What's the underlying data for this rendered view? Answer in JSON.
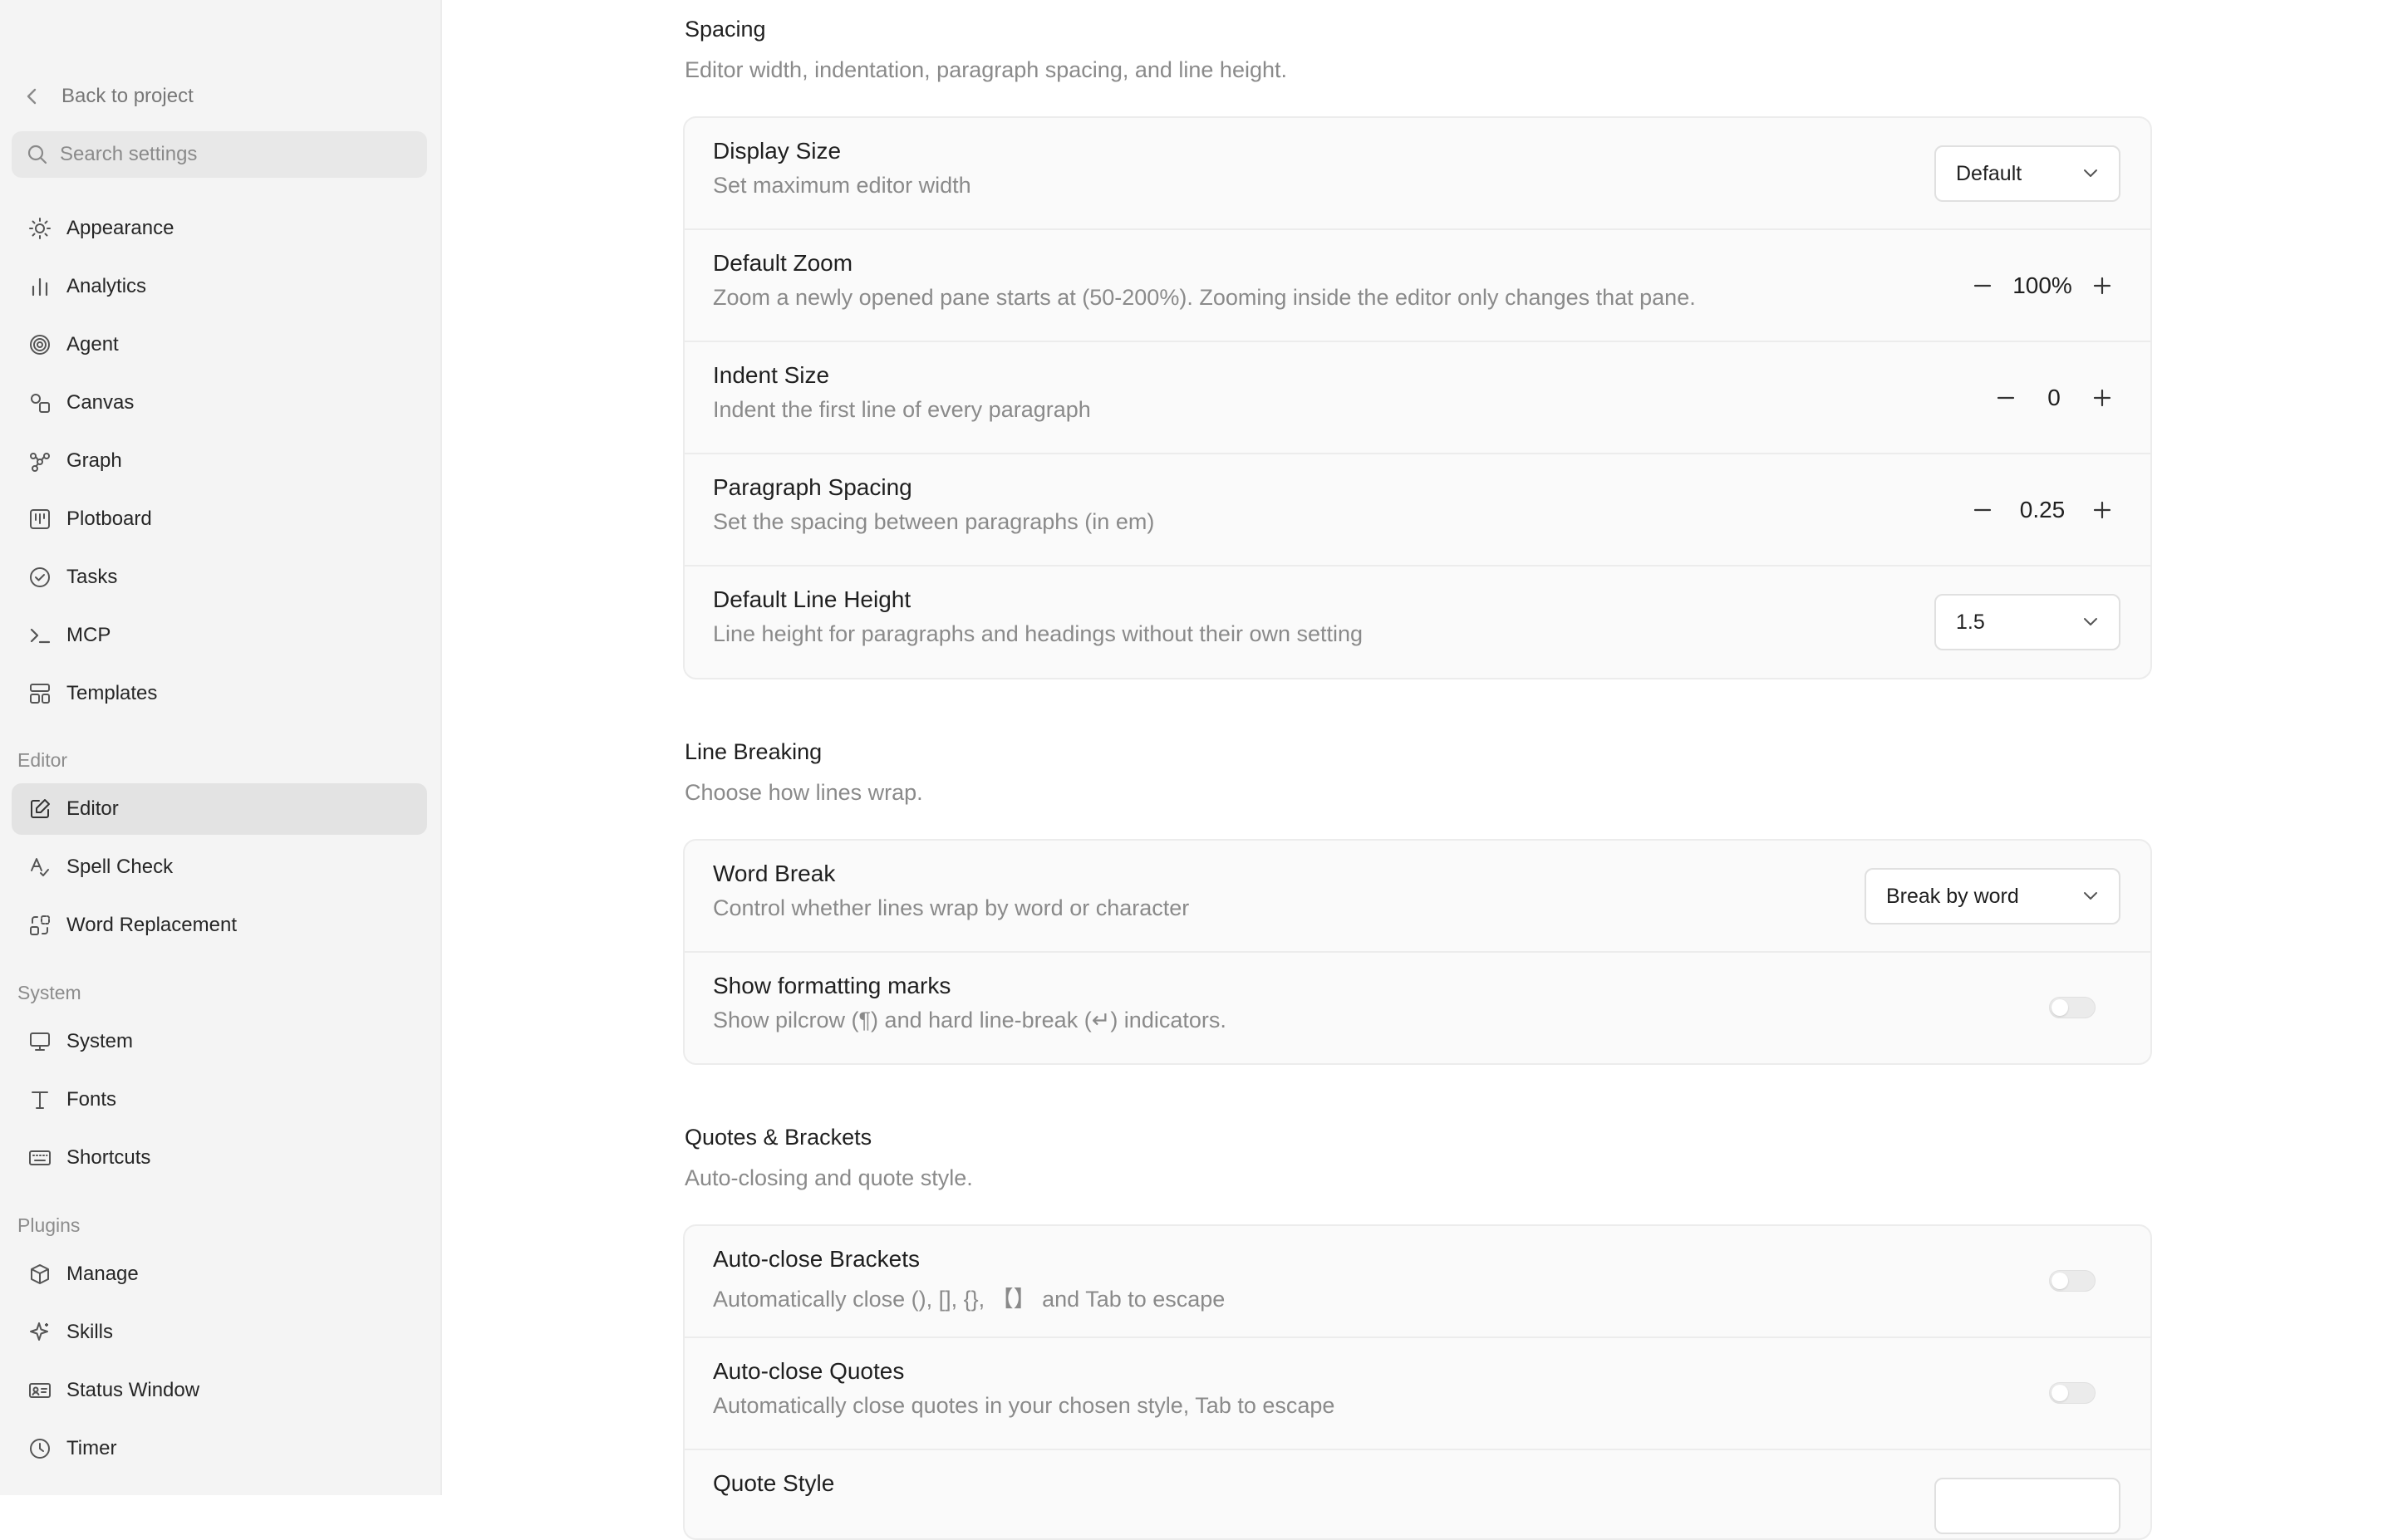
{
  "sidebar": {
    "back_label": "Back to project",
    "search_placeholder": "Search settings",
    "items": [
      {
        "label": "Appearance",
        "icon": "sun-icon"
      },
      {
        "label": "Analytics",
        "icon": "bar-chart-icon"
      },
      {
        "label": "Agent",
        "icon": "spiral-icon"
      },
      {
        "label": "Canvas",
        "icon": "shapes-icon"
      },
      {
        "label": "Graph",
        "icon": "graph-nodes-icon"
      },
      {
        "label": "Plotboard",
        "icon": "kanban-icon"
      },
      {
        "label": "Tasks",
        "icon": "check-circle-icon"
      },
      {
        "label": "MCP",
        "icon": "terminal-icon"
      },
      {
        "label": "Templates",
        "icon": "layout-template-icon"
      }
    ],
    "sections": {
      "editor": {
        "title": "Editor",
        "items": [
          {
            "label": "Editor",
            "icon": "edit-square-icon",
            "active": true
          },
          {
            "label": "Spell Check",
            "icon": "spell-check-icon"
          },
          {
            "label": "Word Replacement",
            "icon": "replace-icon"
          }
        ]
      },
      "system": {
        "title": "System",
        "items": [
          {
            "label": "System",
            "icon": "monitor-icon"
          },
          {
            "label": "Fonts",
            "icon": "type-icon"
          },
          {
            "label": "Shortcuts",
            "icon": "keyboard-icon"
          }
        ]
      },
      "plugins": {
        "title": "Plugins",
        "items": [
          {
            "label": "Manage",
            "icon": "package-icon"
          },
          {
            "label": "Skills",
            "icon": "sparkle-icon"
          },
          {
            "label": "Status Window",
            "icon": "id-card-icon"
          },
          {
            "label": "Timer",
            "icon": "clock-icon"
          }
        ]
      }
    }
  },
  "spacing": {
    "title": "Spacing",
    "description": "Editor width, indentation, paragraph spacing, and line height.",
    "display_size": {
      "title": "Display Size",
      "description": "Set maximum editor width",
      "value": "Default"
    },
    "default_zoom": {
      "title": "Default Zoom",
      "description": "Zoom a newly opened pane starts at (50-200%). Zooming inside the editor only changes that pane.",
      "value": "100%"
    },
    "indent_size": {
      "title": "Indent Size",
      "description": "Indent the first line of every paragraph",
      "value": "0"
    },
    "paragraph_spacing": {
      "title": "Paragraph Spacing",
      "description": "Set the spacing between paragraphs (in em)",
      "value": "0.25"
    },
    "line_height": {
      "title": "Default Line Height",
      "description": "Line height for paragraphs and headings without their own setting",
      "value": "1.5"
    }
  },
  "line_breaking": {
    "title": "Line Breaking",
    "description": "Choose how lines wrap.",
    "word_break": {
      "title": "Word Break",
      "description": "Control whether lines wrap by word or character",
      "value": "Break by word"
    },
    "formatting_marks": {
      "title": "Show formatting marks",
      "description": "Show pilcrow (¶) and hard line-break (↵) indicators.",
      "enabled": false
    }
  },
  "quotes": {
    "title": "Quotes & Brackets",
    "description": "Auto-closing and quote style.",
    "brackets": {
      "title": "Auto-close Brackets",
      "description": "Automatically close (), [], {}, 【】 and Tab to escape",
      "enabled": false
    },
    "quotes_close": {
      "title": "Auto-close Quotes",
      "description": "Automatically close quotes in your chosen style, Tab to escape",
      "enabled": false
    },
    "quote_style": {
      "title": "Quote Style"
    }
  },
  "colors": {
    "sidebar_bg": "#f4f4f4",
    "active_item_bg": "#e3e3e3",
    "card_bg": "#fafafa",
    "muted_text": "#8a8a8a"
  }
}
